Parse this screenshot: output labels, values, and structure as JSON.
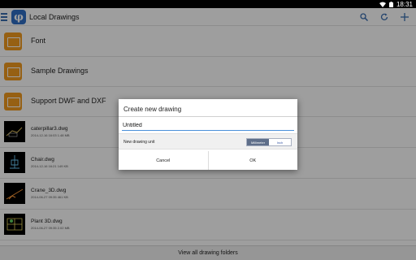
{
  "status_bar": {
    "time": "18:31"
  },
  "app_bar": {
    "logo_letter": "φ",
    "title": "Local Drawings",
    "actions": [
      "search-icon",
      "refresh-icon",
      "add-icon"
    ]
  },
  "folders": [
    {
      "label": "Font"
    },
    {
      "label": "Sample Drawings"
    },
    {
      "label": "Support DWF and DXF"
    }
  ],
  "files": [
    {
      "name": "caterpillar3.dwg",
      "meta": "2014-12-16 16:03  1.48 MB"
    },
    {
      "name": "Chair.dwg",
      "meta": "2014-12-16 16:21  149 KB"
    },
    {
      "name": "Crane_3D.dwg",
      "meta": "2014-06-27 09:35  461 KB"
    },
    {
      "name": "Plant 3D.dwg",
      "meta": "2014-06-27 09:35  2.02 MB"
    }
  ],
  "bottom_bar": {
    "label": "View all drawing folders"
  },
  "dialog": {
    "title": "Create new drawing",
    "input_value": "Untitled",
    "unit_label": "New drawing unit",
    "unit_options": [
      "Millimeter",
      "Inch"
    ],
    "selected_unit": "Millimeter",
    "cancel_label": "Cancel",
    "ok_label": "OK"
  },
  "colors": {
    "accent": "#2f6fc6",
    "folder": "#f39c1f",
    "input_underline": "#4a90d9",
    "segment_selected": "#5f6f8a"
  }
}
